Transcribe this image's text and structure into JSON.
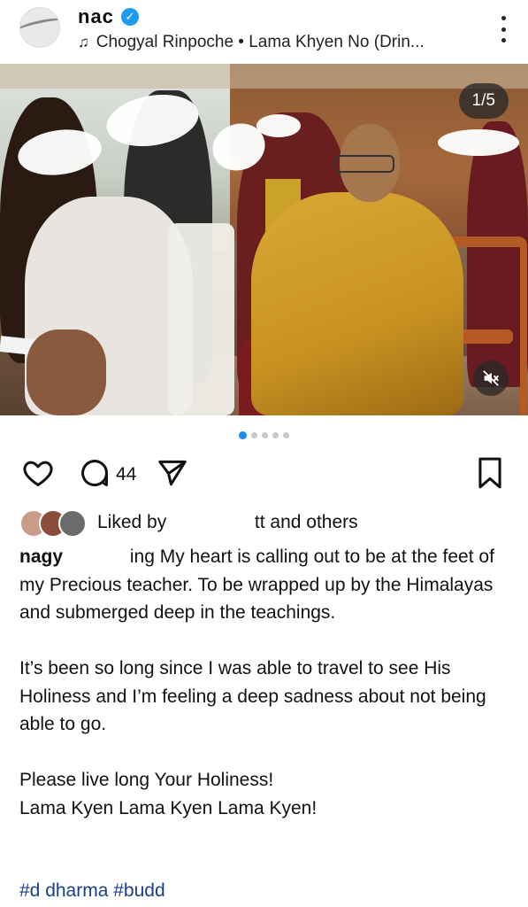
{
  "header": {
    "username": "nac",
    "music": "Chogyal Rinpoche • Lama Khyen No (Drin...",
    "verified_mark": "✓"
  },
  "photo": {
    "counter": "1/5",
    "muted": true
  },
  "carousel": {
    "total_dots": 5,
    "active_index": 0
  },
  "actions": {
    "comment_count": "44"
  },
  "liked": {
    "prefix": "Liked by",
    "user": "tt",
    "suffix": " and others"
  },
  "caption": {
    "user": "nagy",
    "line1": " ing My heart is calling out to be at the feet of my Precious teacher. To be wrapped up by the Himalayas and submerged deep in the teachings.",
    "para2": "It’s been so long since I was able to travel to see His Holiness and I’m feeling a deep sadness about not being able to go.",
    "para3a": "Please live long Your Holiness!",
    "para3b": "Lama Kyen Lama Kyen Lama Kyen!"
  },
  "hashtags": "#d   dharma #budd",
  "colors": {
    "accent_blue": "#1d8cf0",
    "verified_blue": "#1d9bf0",
    "hashtag": "#1a3f8a"
  },
  "icons": {
    "like": "heart-icon",
    "comment": "comment-bubble-icon",
    "share": "paper-plane-icon",
    "save": "bookmark-icon",
    "mute": "speaker-muted-icon",
    "more": "more-vertical-icon",
    "music": "music-note-icon"
  }
}
